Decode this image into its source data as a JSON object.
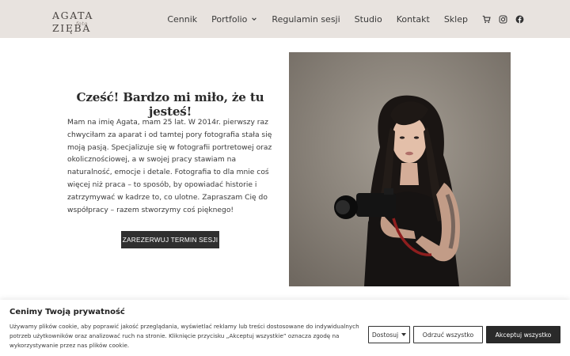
{
  "header": {
    "logo_text": "AGATA ZIĘBA",
    "logo_signature": "foto",
    "nav": {
      "cennik": "Cennik",
      "portfolio": "Portfolio",
      "regulamin": "Regulamin sesji",
      "studio": "Studio",
      "kontakt": "Kontakt",
      "sklep": "Sklep"
    },
    "icons": [
      "cart-icon",
      "instagram-icon",
      "facebook-icon"
    ]
  },
  "hero": {
    "greeting": "Cześć! Bardzo mi miło, że tu jesteś!",
    "bio": "Mam na imię Agata, mam 25 lat. W 2014r. pierwszy raz chwyciłam za aparat i od tamtej pory fotografia stała się moją pasją. Specjalizuje się w fotografii portretowej oraz okolicznościowej, a w swojej pracy stawiam na naturalność, emocje i detale. Fotografia to dla mnie coś więcej niż praca – to sposób, by opowiadać historie i zatrzymywać w kadrze to, co ulotne. Zapraszam Cię do współpracy – razem stworzymy coś pięknego!",
    "cta": "ZAREZERWUJ TERMIN SESJI"
  },
  "cookie": {
    "title": "Cenimy Twoją prywatność",
    "text": "Używamy plików cookie, aby poprawić jakość przeglądania, wyświetlać reklamy lub treści dostosowane do indywidualnych potrzeb użytkowników oraz analizować ruch na stronie. Kliknięcie przycisku „Akceptuj wszystkie” oznacza zgodę na wykorzystywanie przez nas plików cookie.",
    "btn_customize": "Dostosuj",
    "btn_reject": "Odrzuć wszystko",
    "btn_accept": "Akceptuj wszystko"
  },
  "colors": {
    "header_bg": "#e8e3df",
    "button_dark": "#2f2f2f"
  }
}
